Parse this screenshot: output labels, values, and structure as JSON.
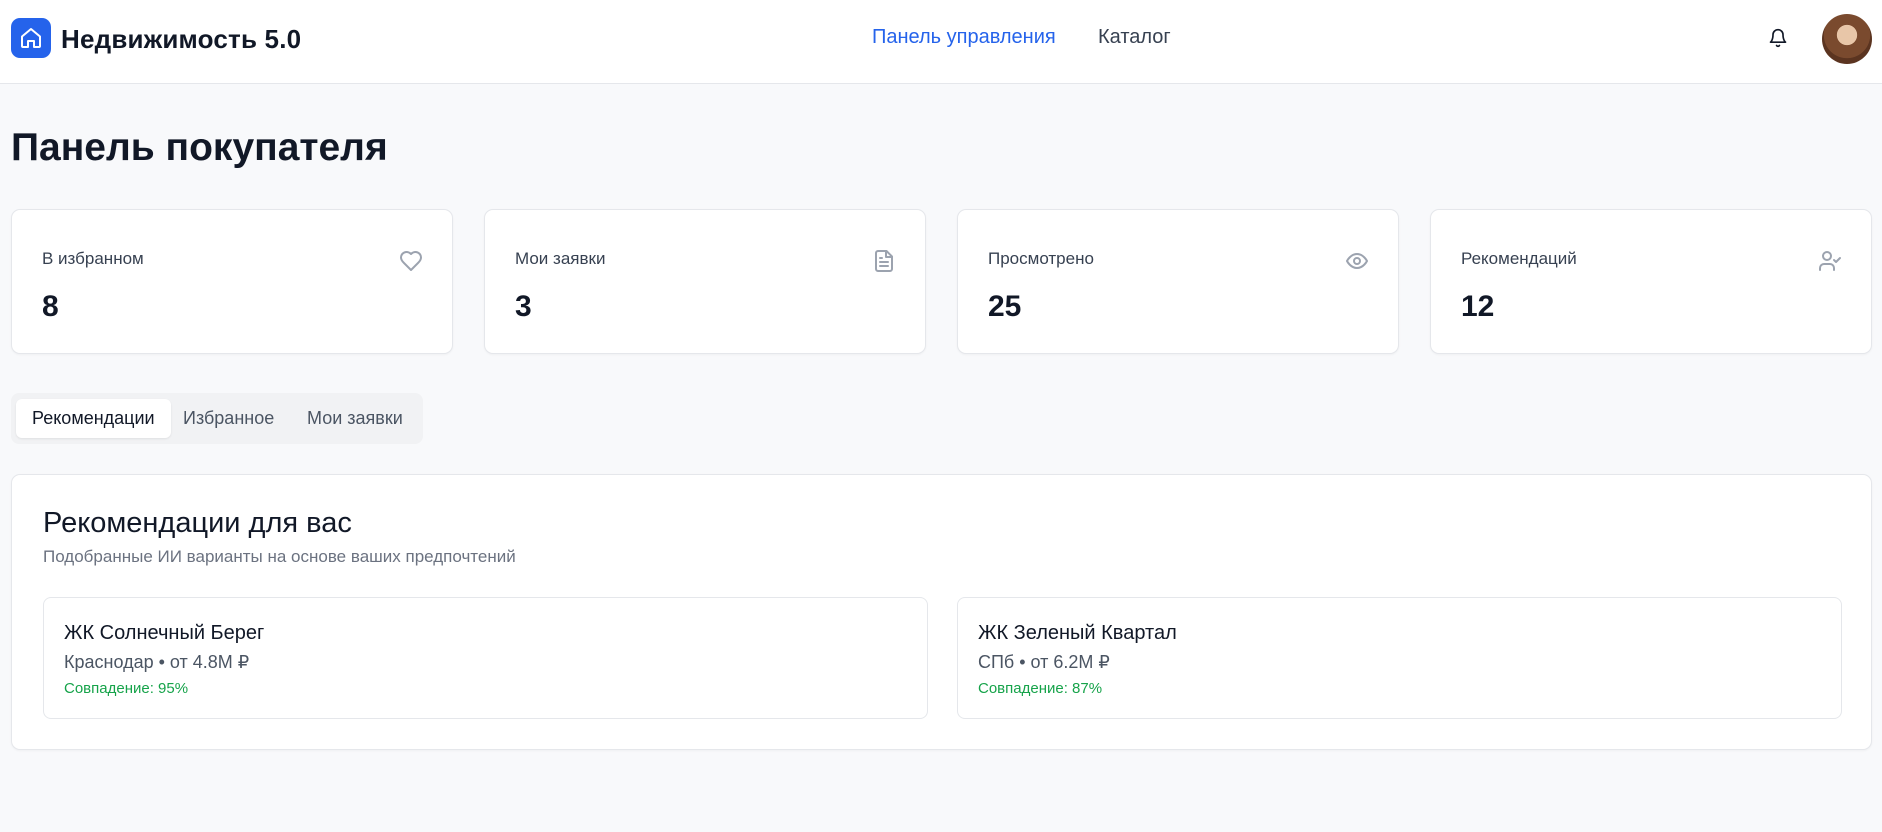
{
  "header": {
    "app_title": "Недвижимость 5.0",
    "logo_icon": "home-icon",
    "nav": [
      {
        "label": "Панель управления",
        "active": true
      },
      {
        "label": "Каталог",
        "active": false
      }
    ],
    "bell_icon": "bell-icon",
    "avatar_icon": "avatar"
  },
  "page": {
    "title": "Панель покупателя"
  },
  "stats": [
    {
      "label": "В избранном",
      "value": "8",
      "icon": "heart-icon"
    },
    {
      "label": "Мои заявки",
      "value": "3",
      "icon": "file-text-icon"
    },
    {
      "label": "Просмотрено",
      "value": "25",
      "icon": "eye-icon"
    },
    {
      "label": "Рекомендаций",
      "value": "12",
      "icon": "user-check-icon"
    }
  ],
  "tabs": [
    {
      "label": "Рекомендации",
      "active": true
    },
    {
      "label": "Избранное",
      "active": false
    },
    {
      "label": "Мои заявки",
      "active": false
    }
  ],
  "recommendations": {
    "title": "Рекомендации для вас",
    "subtitle": "Подобранные ИИ варианты на основе ваших предпочтений",
    "items": [
      {
        "name": "ЖК Солнечный Берег",
        "meta": "Краснодар • от 4.8M ₽",
        "match": "Совпадение: 95%"
      },
      {
        "name": "ЖК Зеленый Квартал",
        "meta": "СПб • от 6.2M ₽",
        "match": "Совпадение: 87%"
      }
    ]
  },
  "colors": {
    "accent": "#2563eb",
    "match_green": "#16a34a",
    "background": "#f8f9fb"
  }
}
